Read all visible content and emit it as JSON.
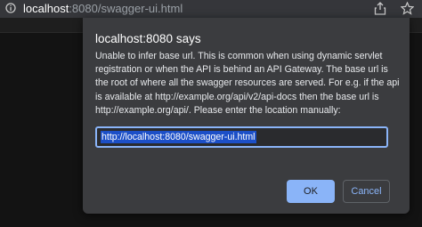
{
  "browser": {
    "url_host": "localhost",
    "url_path": ":8080/swagger-ui.html",
    "icons": {
      "site_info": "info-circle-icon",
      "share": "share-icon",
      "bookmark": "star-icon"
    }
  },
  "dialog": {
    "title": "localhost:8080 says",
    "message": "Unable to infer base url. This is common when using dynamic servlet registration or when the API is behind an API Gateway. The base url is the root of where all the swagger resources are served. For e.g. if the api is available at http://example.org/api/v2/api-docs then the base url is http://example.org/api/. Please enter the location manually:",
    "input_value": "http://localhost:8080/swagger-ui.html",
    "ok_label": "OK",
    "cancel_label": "Cancel"
  },
  "colors": {
    "accent": "#8ab4f8",
    "dialog_bg": "#3b3c3f",
    "selection": "#1c4fc7"
  }
}
